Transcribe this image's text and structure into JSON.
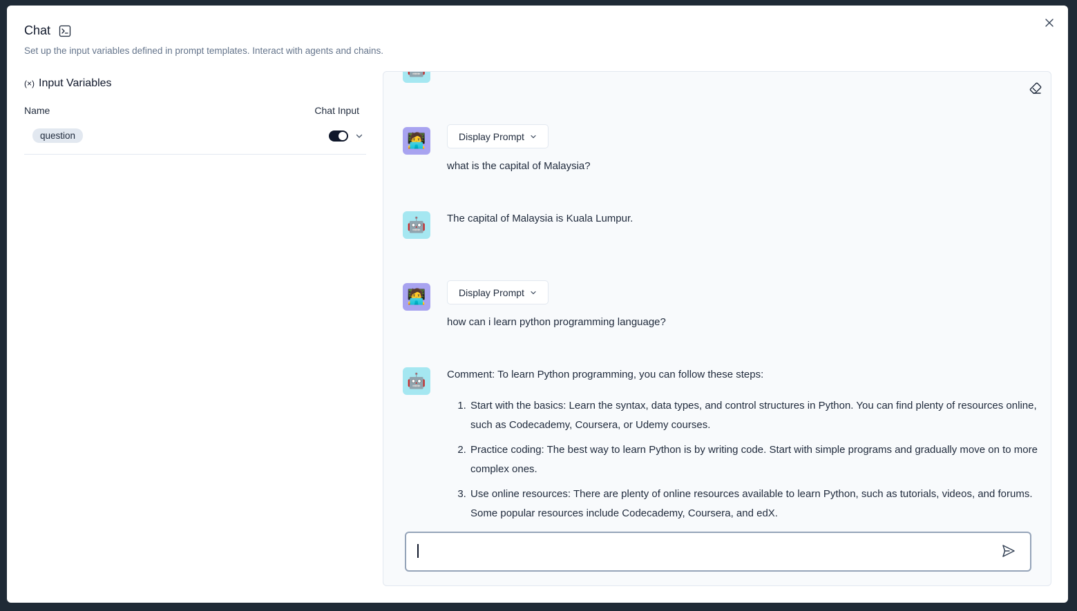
{
  "header": {
    "title": "Chat",
    "subtitle": "Set up the input variables defined in prompt templates. Interact with agents and chains."
  },
  "input_variables": {
    "heading": "Input Variables",
    "col_name": "Name",
    "col_chat_input": "Chat Input",
    "rows": [
      {
        "name": "question",
        "chat_input_enabled": true
      }
    ]
  },
  "chat": {
    "display_prompt_label": "Display Prompt",
    "messages": [
      {
        "role": "user",
        "text": "what is the capital of Malaysia?"
      },
      {
        "role": "bot",
        "text": "The capital of Malaysia is Kuala Lumpur."
      },
      {
        "role": "user",
        "text": "how can i learn python programming language?"
      },
      {
        "role": "bot",
        "text": "Comment: To learn Python programming, you can follow these steps:",
        "list": [
          "Start with the basics: Learn the syntax, data types, and control structures in Python. You can find plenty of resources online, such as Codecademy, Coursera, or Udemy courses.",
          "Practice coding: The best way to learn Python is by writing code. Start with simple programs and gradually move on to more complex ones.",
          "Use online resources: There are plenty of online resources available to learn Python, such as tutorials, videos, and forums. Some popular resources include Codecademy, Coursera, and edX."
        ]
      }
    ],
    "input_value": "",
    "input_placeholder": ""
  },
  "icons": {
    "close": "close-icon",
    "terminal": "terminal-icon",
    "variable": "variable-icon",
    "chevron": "chevron-down-icon",
    "eraser": "eraser-icon",
    "send": "send-icon",
    "bot": "robot-icon",
    "user": "user-icon"
  },
  "colors": {
    "bot_avatar_bg": "#a5e7f1",
    "user_avatar_bg": "#a8a3f0",
    "toggle_on": "#0f172a",
    "backdrop": "#1f2a36"
  }
}
